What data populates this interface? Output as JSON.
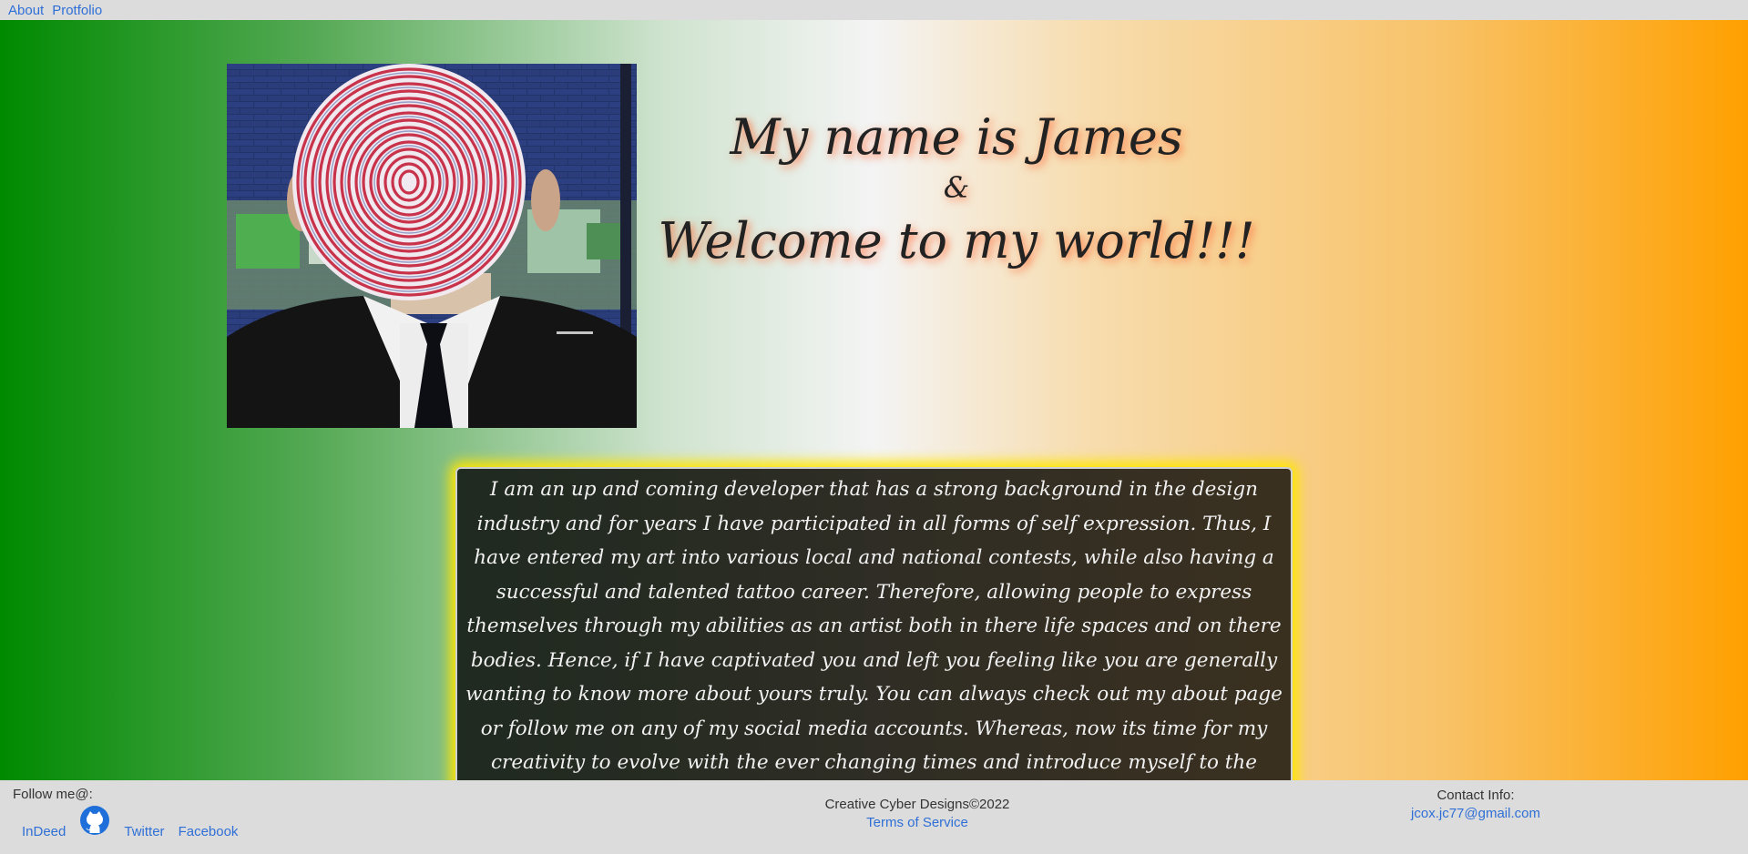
{
  "nav": {
    "items": [
      "About",
      "Protfolio"
    ]
  },
  "hero": {
    "headline_line1": "My name is James",
    "headline_amp": "&",
    "headline_line3": "Welcome to my world!!!",
    "portrait_icon": "spiral-face-portrait"
  },
  "intro": {
    "text": "I am an up and coming developer that has a strong background in the design industry and for years I have participated in all forms of self expression. Thus, I have entered my art into various local and national contests, while also having a successful and talented tattoo career. Therefore, allowing people to express themselves through my abilities as an artist both in there life spaces and on there bodies. Hence, if I have captivated you and left you feeling like you are generally wanting to know more about yours truly. You can always check out my about page or follow me on any of my social media accounts. Whereas, now its time for my creativity to evolve with the ever changing times and introduce myself to the Cyber and Data Driven Era."
  },
  "footer": {
    "follow_label": "Follow me@:",
    "social": {
      "indeed": "InDeed",
      "github_icon": "github-icon",
      "twitter": "Twitter",
      "facebook": "Facebook"
    },
    "copyright": "Creative Cyber Designs©2022",
    "terms": "Terms of Service",
    "contact_label": "Contact Info:",
    "contact_email": "jcox.jc77@gmail.com"
  },
  "colors": {
    "link": "#2f6fd6",
    "gradient_left": "#008a00",
    "gradient_right": "#ffa000",
    "intro_glow": "#ffe600",
    "headline_shadow": "#ff6e3c"
  }
}
